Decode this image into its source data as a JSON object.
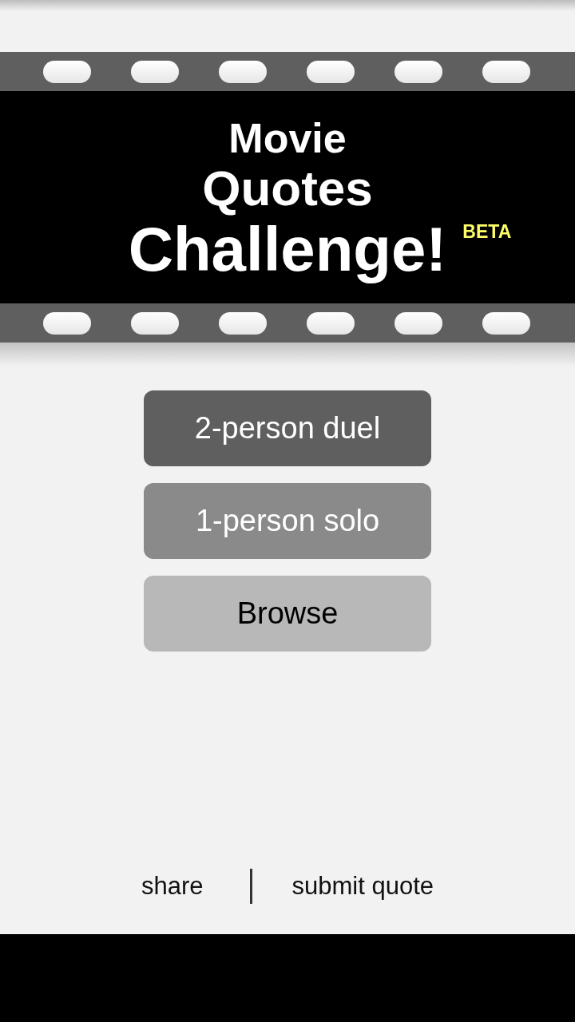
{
  "title": {
    "lines": [
      "Movie",
      "Quotes",
      "Challenge!"
    ],
    "badge": "BETA"
  },
  "buttons": [
    {
      "label": "2-person duel",
      "kind": "dark"
    },
    {
      "label": "1-person solo",
      "kind": "medium"
    },
    {
      "label": "Browse",
      "kind": "light"
    }
  ],
  "footer": {
    "links": [
      "share",
      "submit quote"
    ]
  }
}
